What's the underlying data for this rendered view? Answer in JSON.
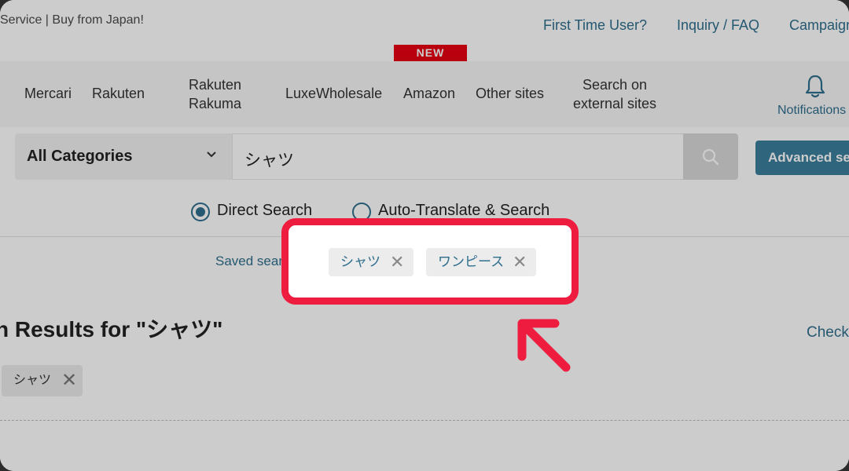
{
  "header": {
    "tagline": "Service | Buy from Japan!",
    "links": [
      "First Time User?",
      "Inquiry / FAQ",
      "Campaign"
    ]
  },
  "new_badge": "NEW",
  "nav": {
    "items": [
      "Mercari",
      "Rakuten",
      "Rakuten\nRakuma",
      "LuxeWholesale",
      "Amazon",
      "Other sites",
      "Search on\nexternal sites"
    ],
    "notifications_label": "Notifications"
  },
  "search": {
    "category": "All Categories",
    "query": "シャツ",
    "advanced_label": "Advanced search"
  },
  "search_mode": {
    "options": [
      {
        "label": "Direct Search",
        "selected": true
      },
      {
        "label": "Auto-Translate & Search",
        "selected": false
      }
    ]
  },
  "saved_search": {
    "label": "Saved search",
    "chips": [
      "シャツ",
      "ワンピース"
    ]
  },
  "results": {
    "title": "n Results for \"シャツ\"",
    "check_label": "Check",
    "filter_chip": "シャツ"
  },
  "colors": {
    "link": "#2f6e8e",
    "highlight": "#ee1c3e",
    "badge": "#e60012",
    "advanced_button": "#3c7f9e"
  }
}
